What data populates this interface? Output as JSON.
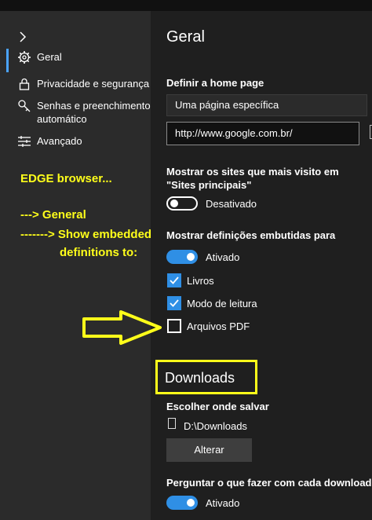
{
  "sidebar": {
    "items": [
      {
        "label": "Geral",
        "icon": "gear-icon"
      },
      {
        "label": "Privacidade e segurança",
        "icon": "lock-icon"
      },
      {
        "label": "Senhas e preenchimento",
        "label2": "automático",
        "icon": "key-icon"
      },
      {
        "label": "Avançado",
        "icon": "sliders-icon"
      }
    ]
  },
  "annotation": {
    "line1": "EDGE browser...",
    "line2": "---> General",
    "line3": "-------> Show embedded",
    "line4": "definitions to:"
  },
  "main": {
    "title": "Geral",
    "home_page": {
      "label": "Definir a home page",
      "select_value": "Uma página específica",
      "url_value": "http://www.google.com.br/"
    },
    "top_sites": {
      "label": "Mostrar os sites que mais visito em \"Sites principais\"",
      "toggle_state": "off",
      "toggle_label": "Desativado"
    },
    "embedded": {
      "label": "Mostrar definições embutidas para",
      "toggle_state": "on",
      "toggle_label": "Ativado",
      "options": [
        {
          "label": "Livros",
          "checked": true
        },
        {
          "label": "Modo de leitura",
          "checked": true
        },
        {
          "label": "Arquivos PDF",
          "checked": false
        }
      ]
    },
    "downloads": {
      "title": "Downloads",
      "save_label": "Escolher onde salvar",
      "path": "D:\\Downloads",
      "change_button": "Alterar",
      "ask_label": "Perguntar o que fazer com cada download",
      "ask_toggle_state": "on",
      "ask_toggle_label": "Ativado"
    }
  },
  "colors": {
    "accent": "#2f8fe5",
    "annotation": "#ffff1a",
    "sidebar_bg": "#2b2b2b",
    "main_bg": "#1f1f1f"
  }
}
